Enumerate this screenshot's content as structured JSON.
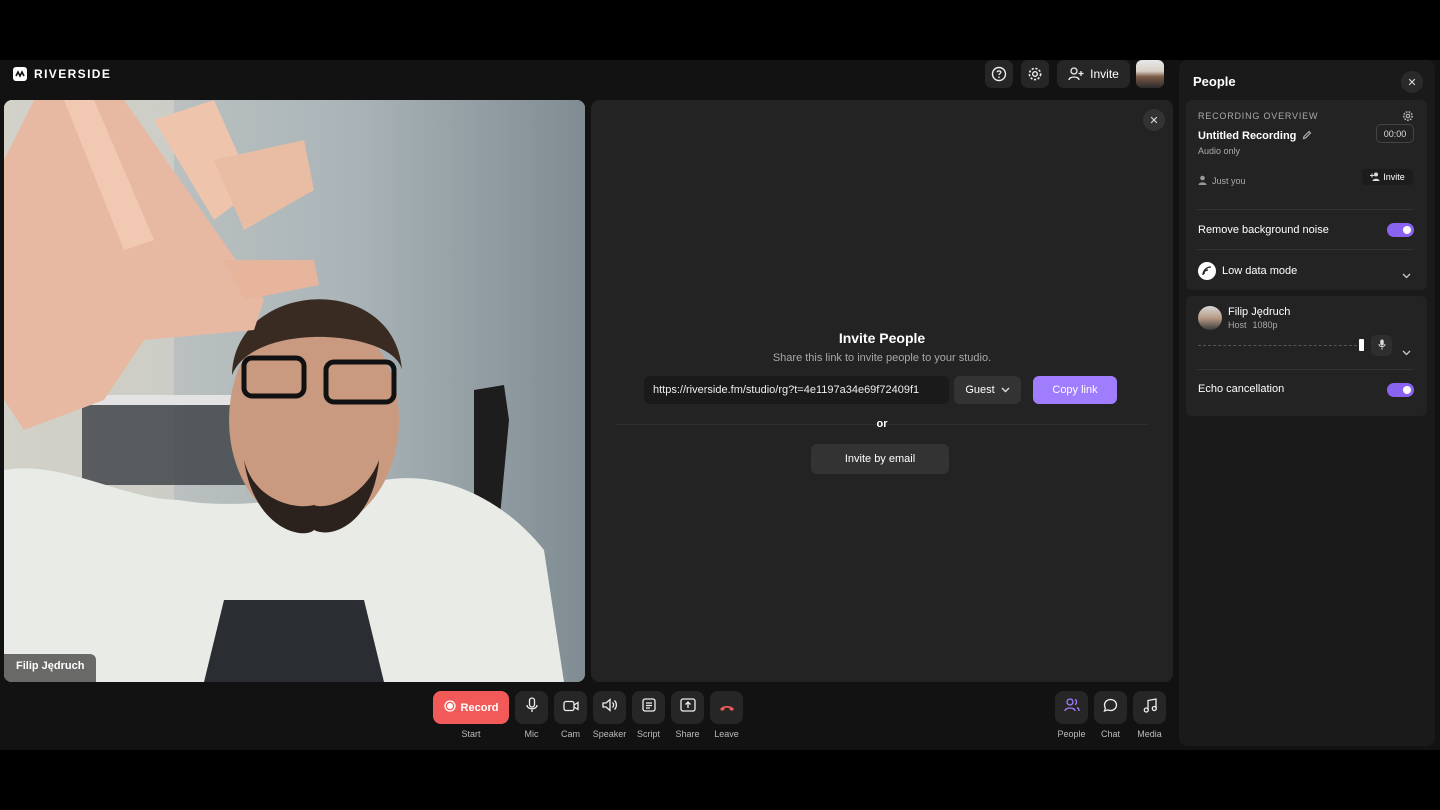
{
  "app": {
    "logo_text": "RIVERSIDE"
  },
  "topbar": {
    "invite_label": "Invite"
  },
  "video": {
    "participant_name": "Filip Jędruch"
  },
  "invite": {
    "title": "Invite People",
    "subtitle": "Share this link to invite people to your studio.",
    "link": "https://riverside.fm/studio/rg?t=4e1197a34e69f72409f1",
    "role": "Guest",
    "copy_label": "Copy link",
    "or_label": "or",
    "email_label": "Invite by email"
  },
  "controls": {
    "record": {
      "button": "Record",
      "label": "Start"
    },
    "mic": "Mic",
    "cam": "Cam",
    "speaker": "Speaker",
    "script": "Script",
    "share": "Share",
    "leave": "Leave",
    "people": "People",
    "chat": "Chat",
    "media": "Media"
  },
  "people_panel": {
    "title": "People",
    "overview": {
      "heading": "RECORDING OVERVIEW",
      "recording_name": "Untitled Recording",
      "timer": "00:00",
      "mode": "Audio only",
      "participants": "Just you",
      "invite_label": "Invite"
    },
    "noise": {
      "label": "Remove background noise",
      "enabled": true
    },
    "low_data": {
      "label": "Low data mode"
    },
    "host": {
      "name": "Filip Jędruch",
      "role": "Host",
      "quality": "1080p",
      "volume_fraction": 1.0,
      "echo_label": "Echo cancellation",
      "echo_enabled": true
    }
  },
  "colors": {
    "accent": "#a07cff",
    "record": "#f25a5a",
    "toggle": "#8a63f0"
  }
}
